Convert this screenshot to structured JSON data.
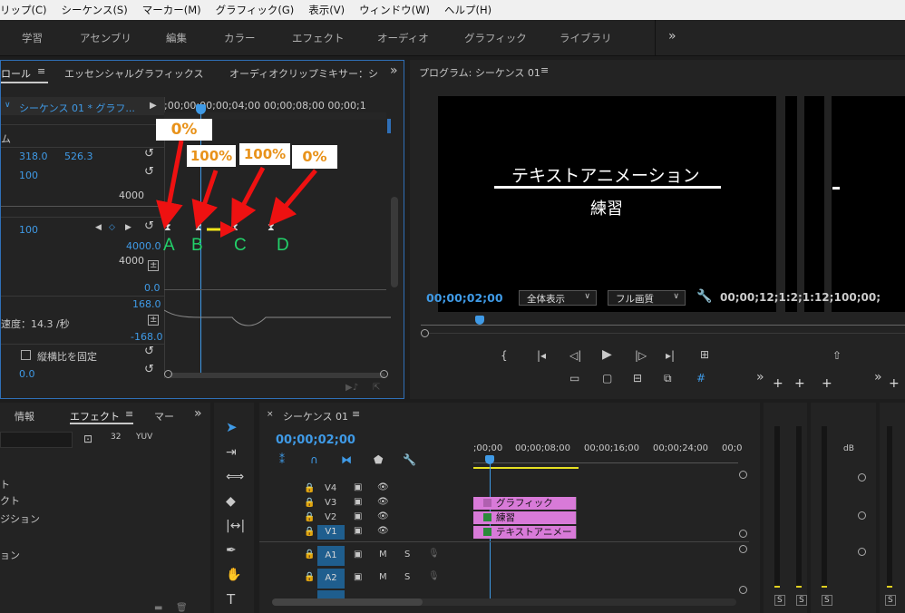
{
  "menu": [
    "リップ(C)",
    "シーケンス(S)",
    "マーカー(M)",
    "グラフィック(G)",
    "表示(V)",
    "ウィンドウ(W)",
    "ヘルプ(H)"
  ],
  "workspaces": [
    "学習",
    "アセンブリ",
    "編集",
    "カラー",
    "エフェクト",
    "オーディオ",
    "グラフィック",
    "ライブラリ"
  ],
  "effect_controls": {
    "tabs": [
      "ロール",
      "エッセンシャルグラフィックス",
      "オーディオクリップミキサー：シ"
    ],
    "clip_name": "シーケンス 01 * グラフ...",
    "ruler": ";00;00;00;00;04;00  00;00;08;00  00;00;1",
    "section": "ム",
    "position_x": "318.0",
    "position_y": "526.3",
    "scale": "100",
    "scale_max": "4000",
    "opacity": "100",
    "graph_max": "4000.0",
    "graph_mid": "4000",
    "graph_zero": "0.0",
    "velocity_max": "168.0",
    "velocity_label": "速度：14.3 /秒",
    "velocity_min": "-168.0",
    "uniform_scale": "縦横比を固定",
    "anchor_value": "0.0"
  },
  "annotations": {
    "callouts": [
      "0%",
      "100%",
      "100%",
      "0%"
    ],
    "letters": [
      "A",
      "B",
      "C",
      "D"
    ]
  },
  "program_monitor": {
    "title": "プログラム: シーケンス 01",
    "text_line1": "テキストアニメーション",
    "text_line2": "練習",
    "timecode": "00;00;02;00",
    "zoom": "全体表示",
    "quality": "フル画質",
    "duration": "00;00;12;1:2;1:12;1",
    "duration2": "00;00;"
  },
  "effects_panel": {
    "tabs": [
      "情報",
      "エフェクト",
      "マー"
    ],
    "items": [
      "ト",
      "クト",
      "ジション",
      "ョン"
    ]
  },
  "timeline": {
    "title": "シーケンス 01",
    "timecode": "00;00;02;00",
    "ruler": [
      ";00;00",
      "00;00;08;00",
      "00;00;16;00",
      "00;00;24;00",
      "00;0"
    ],
    "video_tracks": [
      "V4",
      "V3",
      "V2",
      "V1"
    ],
    "audio_tracks": [
      "A1",
      "A2"
    ],
    "clips": [
      "グラフィック",
      "練習",
      "テキストアニメー"
    ],
    "m_label": "M",
    "s_label": "S"
  },
  "meters": {
    "s_labels": [
      "S",
      "S",
      "S",
      "S"
    ],
    "db": "dB"
  },
  "colors": {
    "accent": "#3f9ae6",
    "clip": "#d87ad8",
    "callout_text": "#e8921a",
    "arrow": "#ee1111",
    "letter": "#22d16a"
  }
}
